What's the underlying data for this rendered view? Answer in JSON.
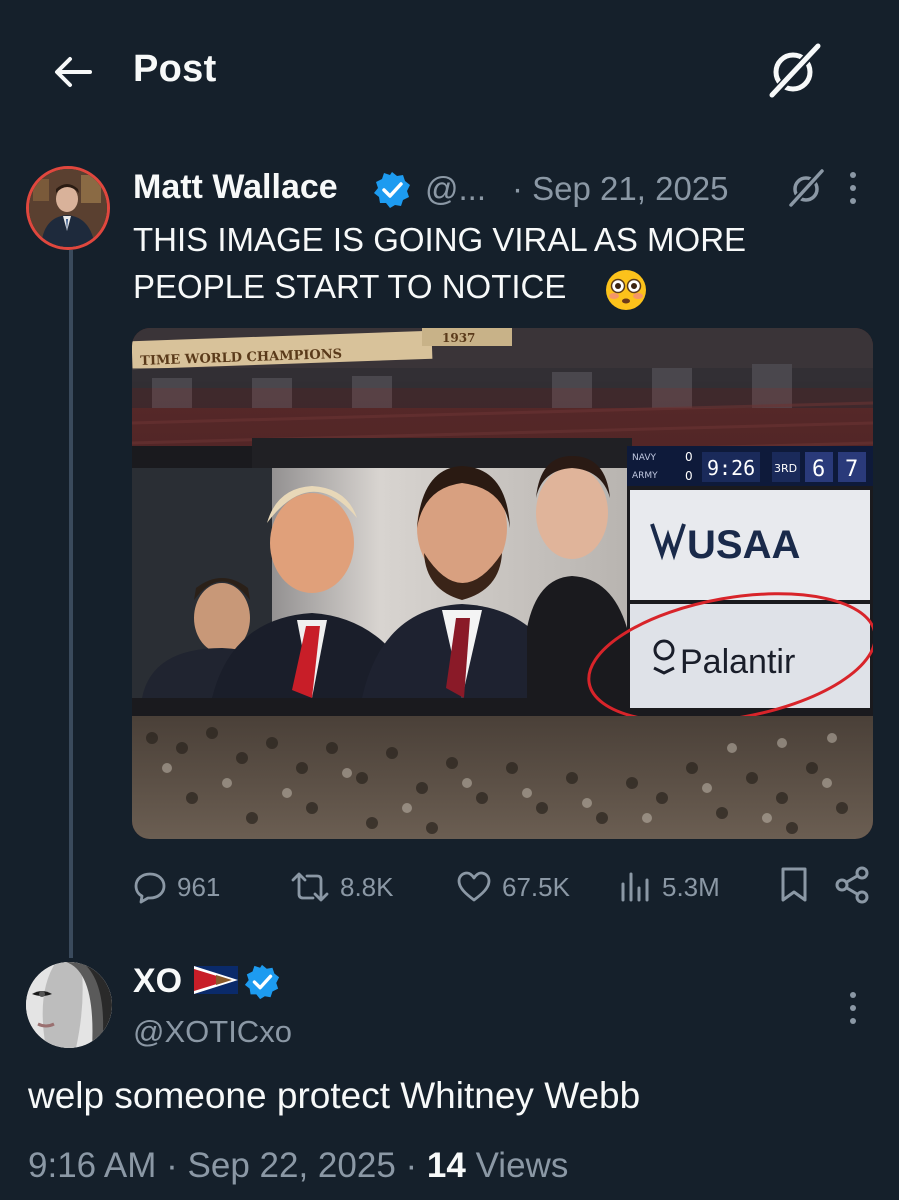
{
  "header": {
    "title": "Post"
  },
  "tweet": {
    "author_name": "Matt Wallace",
    "handle": "@...",
    "date": "· Sep 21, 2025",
    "text_line1": "THIS IMAGE IS GOING VIRAL AS MORE",
    "text_line2": "PEOPLE START TO NOTICE",
    "media": {
      "banner_text": "TIME WORLD CHAMPIONS",
      "banner_number": "1937",
      "scoreboard_clock": "9:26",
      "scoreboard_score_left": "6",
      "scoreboard_score_right": "7",
      "scoreboard_row_left": "0",
      "scoreboard_row_left2": "0",
      "scoreboard_label_top": "NAVY",
      "scoreboard_label_bottom": "ARMY",
      "scoreboard_quarter": "3RD",
      "sponsor1": "USAA",
      "sponsor2": "Palantir"
    },
    "stats": {
      "replies": "961",
      "reposts": "8.8K",
      "likes": "67.5K",
      "views": "5.3M"
    }
  },
  "reply": {
    "author_name": "XO",
    "handle": "@XOTICxo",
    "text": "welp someone protect Whitney Webb",
    "time": "9:16 AM",
    "date": "Sep 22, 2025",
    "views_count": "14",
    "views_label": "Views"
  },
  "colors": {
    "background": "#15202b",
    "text": "#f7f9f9",
    "secondary": "#8b98a5",
    "verified": "#1d9bf0",
    "avatar_ring": "#e0473e"
  }
}
